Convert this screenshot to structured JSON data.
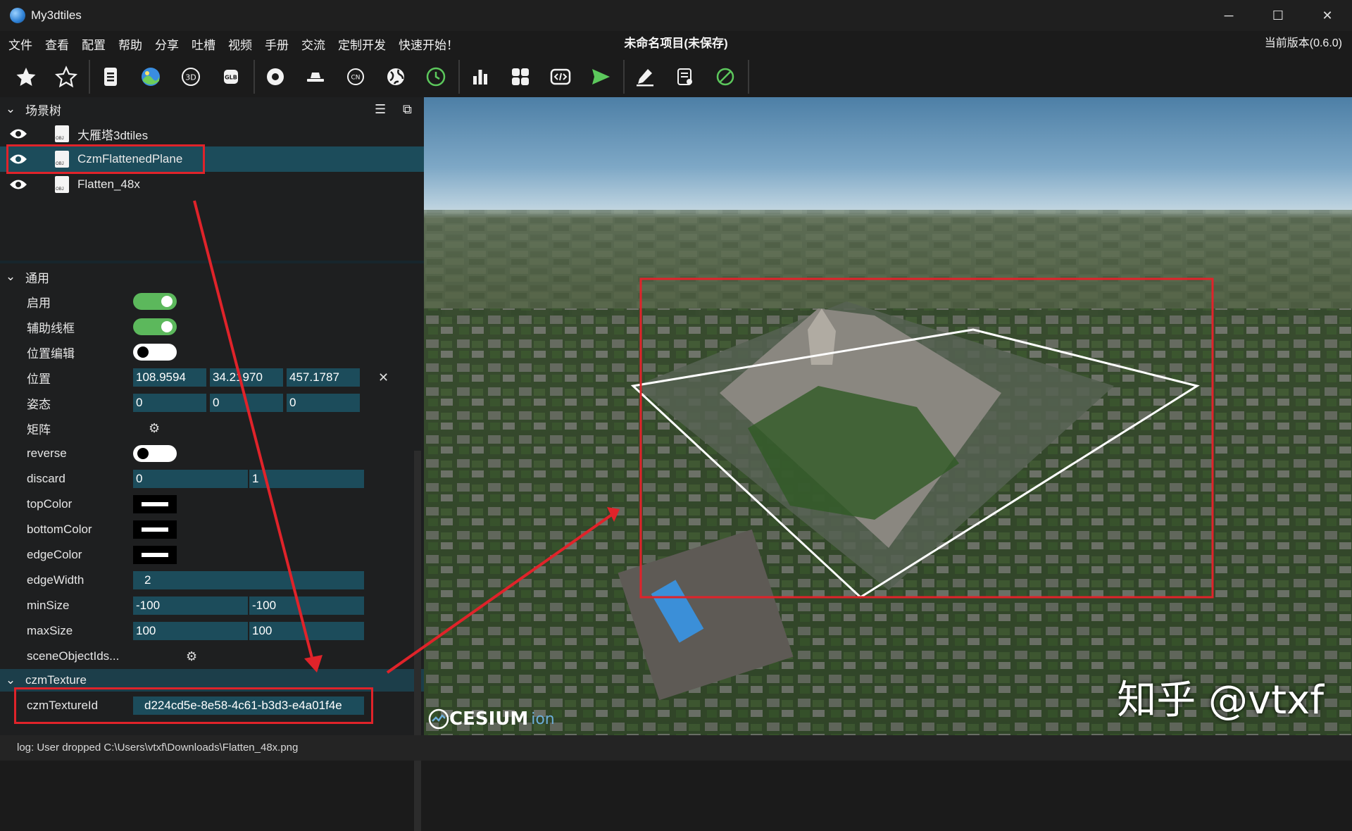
{
  "app": {
    "title": "My3dtiles",
    "project_title": "未命名项目(未保存)",
    "version": "当前版本(0.6.0)"
  },
  "menu": [
    "文件",
    "查看",
    "配置",
    "帮助",
    "分享",
    "吐槽",
    "视频",
    "手册",
    "交流",
    "定制开发",
    "快速开始！"
  ],
  "window_controls": {
    "minimize": "─",
    "maximize": "☐",
    "close": "✕"
  },
  "toolbar": {
    "icons": [
      "star-filled-icon",
      "star-outline-icon",
      "document-icon",
      "globe-image-icon",
      "3d-icon",
      "glb-icon",
      "target-icon",
      "hat-icon",
      "cn-icon",
      "globe-icon",
      "clock-icon",
      "bar-chart-icon",
      "grid-icon",
      "code-icon",
      "send-icon",
      "edit-icon",
      "form-icon",
      "disable-icon"
    ],
    "glb_text": "GLB",
    "cn_text": "CN",
    "3d_text": "3D"
  },
  "scene_tree": {
    "title": "场景树",
    "items": [
      {
        "label": "大雁塔3dtiles"
      },
      {
        "label": "CzmFlattenedPlane"
      },
      {
        "label": "Flatten_48x"
      }
    ]
  },
  "general": {
    "title": "通用",
    "enable_label": "启用",
    "enable": true,
    "wireframe_label": "辅助线框",
    "wireframe": true,
    "position_edit_label": "位置编辑",
    "position_edit": false,
    "position_label": "位置",
    "position": [
      "108.9594",
      "34.21970",
      "457.1787"
    ],
    "position_clear": "✕",
    "attitude_label": "姿态",
    "attitude": [
      "0",
      "0",
      "0"
    ],
    "matrix_label": "矩阵",
    "reverse_label": "reverse",
    "reverse": false,
    "discard_label": "discard",
    "discard": [
      "0",
      "1"
    ],
    "topColor_label": "topColor",
    "bottomColor_label": "bottomColor",
    "edgeColor_label": "edgeColor",
    "edgeWidth_label": "edgeWidth",
    "edgeWidth": "2",
    "minSize_label": "minSize",
    "minSize": [
      "-100",
      "-100"
    ],
    "maxSize_label": "maxSize",
    "maxSize": [
      "100",
      "100"
    ],
    "sceneObjectIds_label": "sceneObjectIds...",
    "gear_glyph": "⚙"
  },
  "czmTexture": {
    "title": "czmTexture",
    "id_label": "czmTextureId",
    "id_value": "d224cd5e-8e58-4c61-b3d3-e4a01f4e"
  },
  "viewport": {
    "watermark": "知乎 @vtxf",
    "cesium_logo": "CESIUM",
    "cesium_ion": "ion"
  },
  "status": {
    "log": "log: User dropped C:\\Users\\vtxf\\Downloads\\Flatten_48x.png"
  },
  "colors": {
    "accent_field": "#1c4c5b",
    "toggle_on": "#5cb85c",
    "highlight_red": "#e0232a"
  }
}
